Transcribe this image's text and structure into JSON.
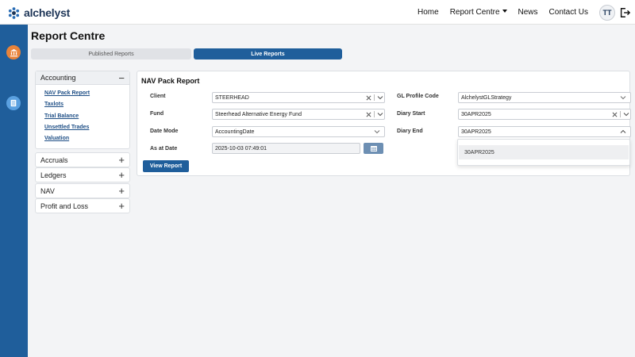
{
  "brand": {
    "name": "alchelyst"
  },
  "nav": {
    "links": [
      "Home",
      "Report Centre",
      "News",
      "Contact Us"
    ],
    "avatar_initials": "TT"
  },
  "page": {
    "title": "Report Centre",
    "tabs": {
      "published": "Published Reports",
      "live": "Live Reports",
      "active": "live"
    }
  },
  "sidebar": {
    "sections": [
      {
        "label": "Accounting",
        "expanded": true,
        "links": [
          "NAV Pack Report",
          "Taxlots",
          "Trial Balance",
          "Unsettled Trades",
          "Valuation"
        ]
      },
      {
        "label": "Accruals",
        "expanded": false
      },
      {
        "label": "Ledgers",
        "expanded": false
      },
      {
        "label": "NAV",
        "expanded": false
      },
      {
        "label": "Profit and Loss",
        "expanded": false
      }
    ]
  },
  "form": {
    "title": "NAV Pack Report",
    "client": {
      "label": "Client",
      "value": "STEERHEAD"
    },
    "fund": {
      "label": "Fund",
      "value": "Steerhead Alternative Energy Fund"
    },
    "date_mode": {
      "label": "Date Mode",
      "value": "AccountingDate"
    },
    "as_at_date": {
      "label": "As at Date",
      "value": "2025-10-03 07:49:01"
    },
    "gl_profile_code": {
      "label": "GL Profile Code",
      "value": "AlchelystGLStrategy"
    },
    "diary_start": {
      "label": "Diary Start",
      "value": "30APR2025"
    },
    "diary_end": {
      "label": "Diary End",
      "value": "30APR2025",
      "options": [
        "30APR2025"
      ]
    },
    "submit_label": "View Report"
  },
  "icons": {
    "logo": "alchelyst-logo-icon",
    "logout": "logout-icon",
    "rail": [
      "bank-icon",
      "report-icon"
    ],
    "calendar": "calendar-icon",
    "clear": "close-icon",
    "dropdown": "chevron-down-icon"
  },
  "colors": {
    "brand_blue": "#1f5e9b",
    "rail_bank_icon": "#e8833a",
    "rail_report_icon": "#5aa0e0",
    "calendar_button": "#6d8fb3"
  }
}
